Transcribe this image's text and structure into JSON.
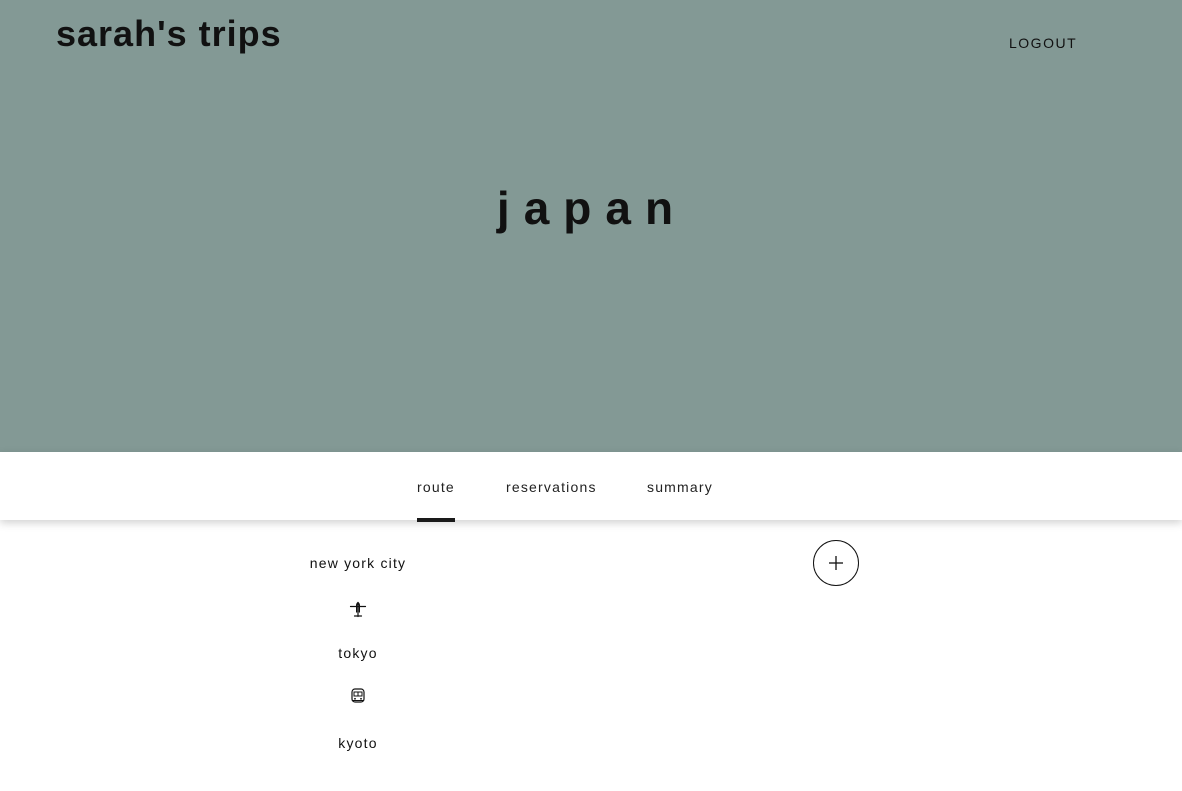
{
  "header": {
    "brand": "sarah's trips",
    "logout_label": "LOGOUT"
  },
  "trip": {
    "title": "japan"
  },
  "tabs": [
    {
      "label": "route",
      "active": true
    },
    {
      "label": "reservations",
      "active": false
    },
    {
      "label": "summary",
      "active": false
    }
  ],
  "route": {
    "stops": [
      {
        "name": "new york city"
      },
      {
        "name": "tokyo"
      },
      {
        "name": "kyoto"
      }
    ],
    "legs": [
      {
        "mode": "airplane-icon"
      },
      {
        "mode": "train-icon"
      }
    ],
    "add_icon": "plus-circle-icon"
  },
  "colors": {
    "hero_background": "#839995",
    "page_background": "#ffffff",
    "text": "#111111"
  }
}
